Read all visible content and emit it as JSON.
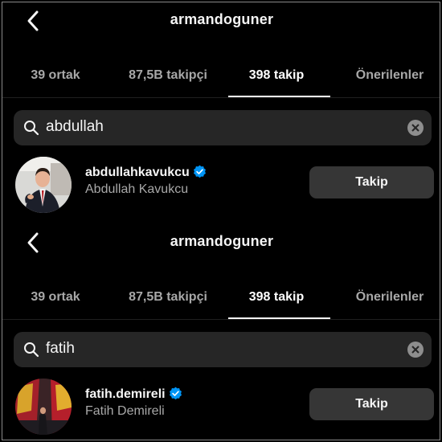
{
  "panels": [
    {
      "header": {
        "title": "armandoguner"
      },
      "tabs": [
        {
          "label": "39 ortak"
        },
        {
          "label": "87,5B takipçi"
        },
        {
          "label": "398 takip"
        },
        {
          "label": "Önerilenler"
        }
      ],
      "active_tab": "398 takip",
      "search": {
        "value": "abdullah"
      },
      "result": {
        "username": "abdullahkavukcu",
        "full_name": "Abdullah Kavukcu",
        "verified": true,
        "follow_label": "Takip"
      }
    },
    {
      "header": {
        "title": "armandoguner"
      },
      "tabs": [
        {
          "label": "39 ortak"
        },
        {
          "label": "87,5B takipçi"
        },
        {
          "label": "398 takip"
        },
        {
          "label": "Önerilenler"
        }
      ],
      "active_tab": "398 takip",
      "search": {
        "value": "fatih"
      },
      "result": {
        "username": "fatih.demireli",
        "full_name": "Fatih Demireli",
        "verified": true,
        "follow_label": "Takip"
      }
    }
  ],
  "colors": {
    "background": "#000000",
    "search_bg": "#262626",
    "button_bg": "#363636",
    "verified_blue": "#0095f6",
    "muted_text": "#a8a8a8"
  }
}
